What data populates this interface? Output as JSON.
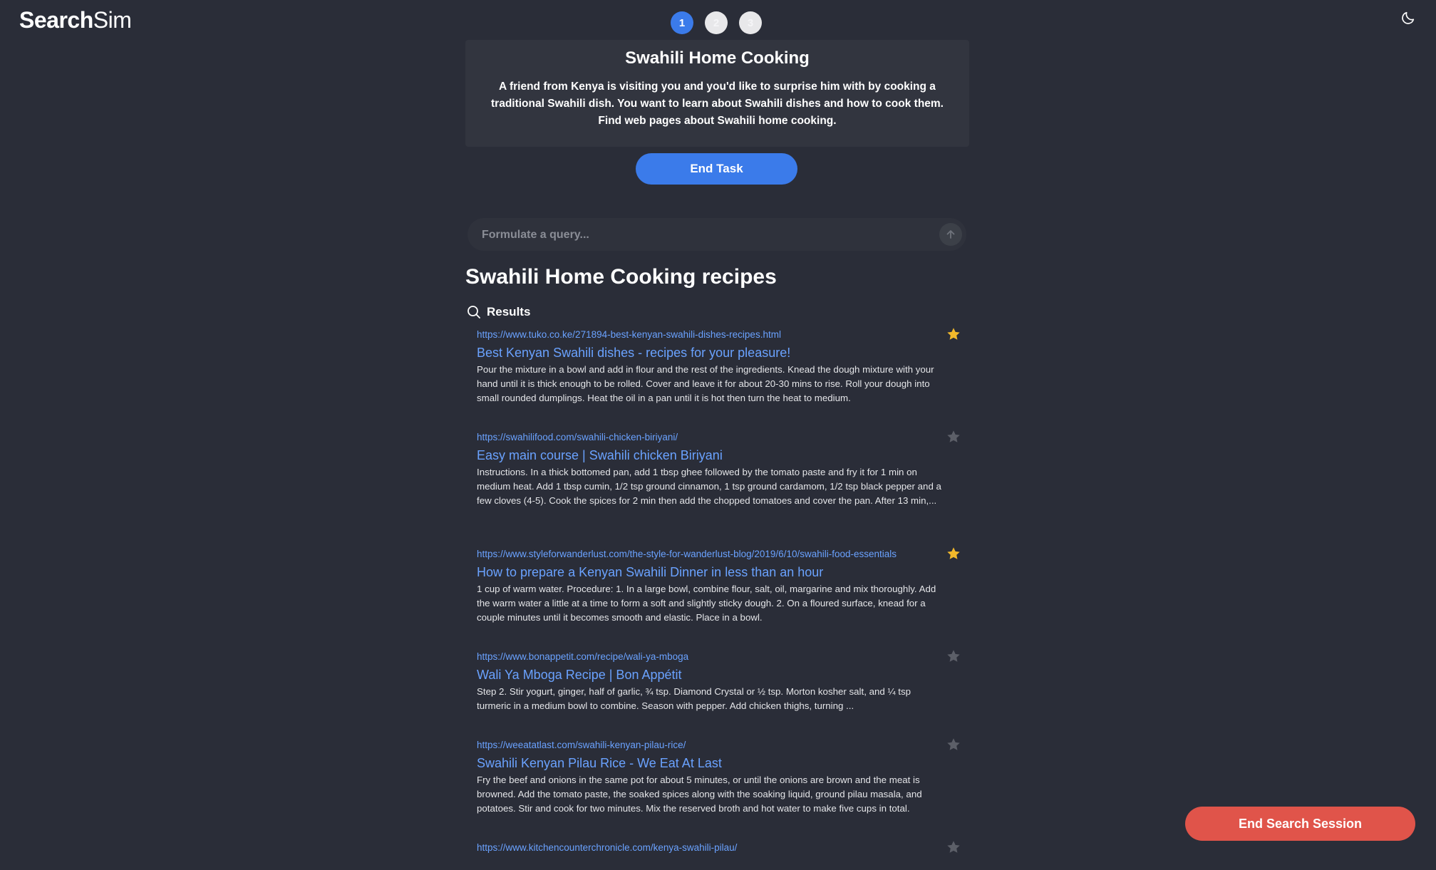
{
  "app": {
    "logo_bold": "Search",
    "logo_light": "Sim"
  },
  "steps": [
    "1",
    "2",
    "3"
  ],
  "task": {
    "title": "Swahili Home Cooking",
    "description": "A friend from Kenya is visiting you and you'd like to surprise him with by cooking a traditional Swahili dish. You want to learn about Swahili dishes and how to cook them. Find web pages about Swahili home cooking.",
    "end_task_label": "End Task"
  },
  "search": {
    "placeholder": "Formulate a query...",
    "value": ""
  },
  "query_heading": "Swahili Home Cooking recipes",
  "results_label": "Results",
  "results": [
    {
      "url": "https://www.tuko.co.ke/271894-best-kenyan-swahili-dishes-recipes.html",
      "title": "Best Kenyan Swahili dishes - recipes for your pleasure!",
      "snippet": "Pour the mixture in a bowl and add in flour and the rest of the ingredients. Knead the dough mixture with your hand until it is thick enough to be rolled. Cover and leave it for about 20-30 mins to rise. Roll your dough into small rounded dumplings. Heat the oil in a pan until it is hot then turn the heat to medium.",
      "starred": true
    },
    {
      "url": "https://swahilifood.com/swahili-chicken-biriyani/",
      "title": "Easy main course | Swahili chicken Biriyani",
      "snippet": "Instructions. In a thick bottomed pan, add 1 tbsp ghee followed by the tomato paste and fry it for 1 min on medium heat. Add 1 tbsp cumin, 1/2 tsp ground cinnamon, 1 tsp ground cardamom, 1/2 tsp black pepper and a few cloves (4-5). Cook the spices for 2 min then add the chopped tomatoes and cover the pan. After 13 min,...",
      "starred": false
    },
    {
      "url": "https://www.styleforwanderlust.com/the-style-for-wanderlust-blog/2019/6/10/swahili-food-essentials",
      "title": "How to prepare a Kenyan Swahili Dinner in less than an hour",
      "snippet": "1 cup of warm water. Procedure: 1. In a large bowl, combine flour, salt, oil, margarine and mix thoroughly. Add the warm water a little at a time to form a soft and slightly sticky dough. 2. On a floured surface, knead for a couple minutes until it becomes smooth and elastic. Place in a bowl.",
      "starred": true
    },
    {
      "url": "https://www.bonappetit.com/recipe/wali-ya-mboga",
      "title": "Wali Ya Mboga Recipe | Bon Appétit",
      "snippet": "Step 2. Stir yogurt, ginger, half of garlic, ¾ tsp. Diamond Crystal or ½ tsp. Morton kosher salt, and ¼ tsp turmeric in a medium bowl to combine. Season with pepper. Add chicken thighs, turning ...",
      "starred": false
    },
    {
      "url": "https://weeatatlast.com/swahili-kenyan-pilau-rice/",
      "title": "Swahili Kenyan Pilau Rice - We Eat At Last",
      "snippet": "Fry the beef and onions in the same pot for about 5 minutes, or until the onions are brown and the meat is browned. Add the tomato paste, the soaked spices along with the soaking liquid, ground pilau masala, and potatoes. Stir and cook for two minutes. Mix the reserved broth and hot water to make five cups in total.",
      "starred": false
    },
    {
      "url": "https://www.kitchencounterchronicle.com/kenya-swahili-pilau/",
      "title": "",
      "snippet": "",
      "starred": false
    }
  ],
  "end_session_label": "End Search Session",
  "colors": {
    "background": "#2a2d38",
    "card": "#32353f",
    "accent": "#3b7bea",
    "link": "#6aa2ff",
    "star_active": "#f2b92b",
    "star_inactive": "#5c5f68",
    "danger": "#e0544a"
  },
  "icons": {
    "theme_toggle": "moon-icon",
    "submit": "arrow-up-icon",
    "results": "search-icon",
    "star": "star-icon"
  }
}
